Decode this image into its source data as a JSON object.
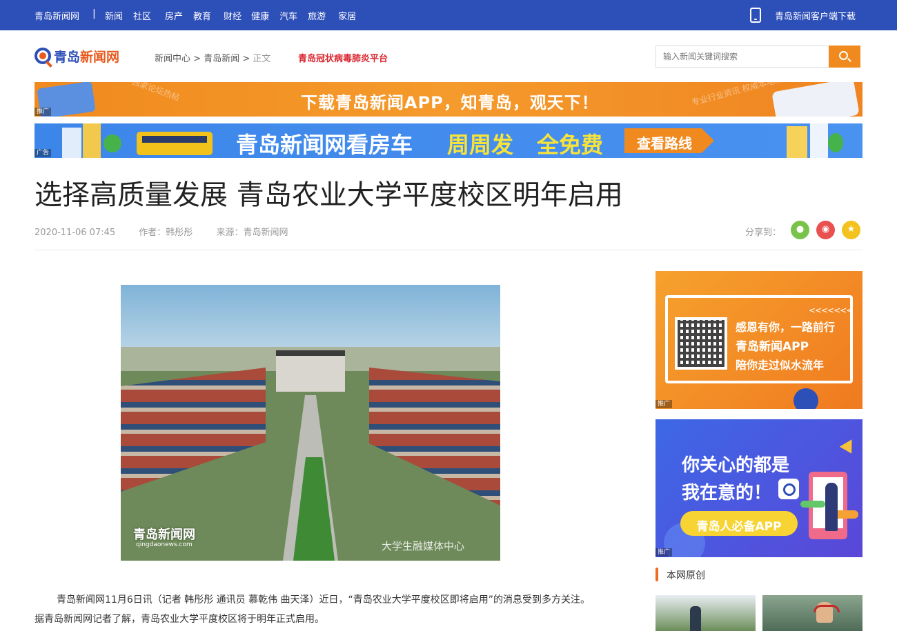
{
  "topbar": {
    "site_name": "青岛新闻网",
    "separator": "|",
    "nav": [
      "新闻",
      "社区",
      "房产",
      "教育",
      "财经",
      "健康",
      "汽车",
      "旅游",
      "家居"
    ],
    "download": "青岛新闻客户端下载"
  },
  "header": {
    "logo_text_a": "青岛",
    "logo_text_b": "新闻网",
    "breadcrumb": [
      "新闻中心",
      "青岛新闻",
      "正文"
    ],
    "breadcrumb_sep": ">",
    "covid_link": "青岛冠状病毒肺炎平台",
    "search_placeholder": "输入新闻关键词搜索"
  },
  "banners": {
    "b1_text": "下载青岛新闻APP，知青岛，观天下！",
    "b1_deco_left": "独家论坛热帖",
    "b1_deco_right": "专业行业资讯 权威本地新闻",
    "b1_tag": "推广",
    "b2_text_a": "青岛新闻网看房车",
    "b2_text_b": "周周发",
    "b2_text_c": "全免费",
    "b2_button": "查看路线",
    "b2_tag": "广告"
  },
  "article": {
    "title": "选择高质量发展 青岛农业大学平度校区明年启用",
    "date": "2020-11-06 07:45",
    "author": "作者：韩彤彤",
    "source": "来源：青岛新闻网",
    "share_label": "分享到：",
    "photo_watermark": "青岛新闻网",
    "photo_watermark_sub": "qingdaonews.com",
    "photo_watermark_right": "大学生融媒体中心",
    "paragraph": "青岛新闻网11月6日讯（记者 韩彤彤 通讯员 慕乾伟 曲天泽）近日，“青岛农业大学平度校区即将启用”的消息受到多方关注。据青岛新闻网记者了解，青岛农业大学平度校区将于明年正式启用。"
  },
  "sidebar": {
    "ad1_line1": "感恩有你，一路前行",
    "ad1_line2": "青岛新闻APP",
    "ad1_line3": "陪你走过似水流年",
    "ad1_arrows": "<<<<<<<",
    "ad1_tag": "推广",
    "ad2_line1": "你关心的都是",
    "ad2_line2": "我在意的！",
    "ad2_pill": "青岛人必备APP",
    "ad2_tag": "推广",
    "section_title": "本网原创"
  },
  "colors": {
    "topbar_blue": "#2d4fb8",
    "accent_orange": "#f08a1e",
    "covid_red": "#d9232d"
  }
}
